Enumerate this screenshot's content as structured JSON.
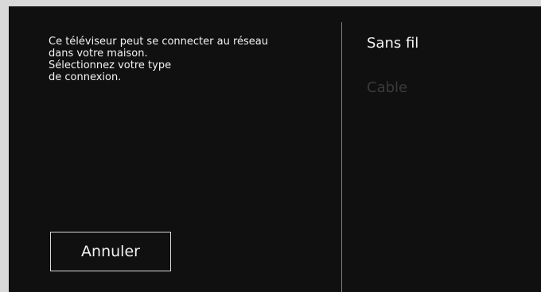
{
  "dialog": {
    "message_lines": [
      "Ce téléviseur peut se connecter au réseau",
      "dans votre maison.",
      "Sélectionnez votre type",
      "de connexion."
    ],
    "cancel_label": "Annuler"
  },
  "options": [
    {
      "label": "Sans fil",
      "state": "enabled"
    },
    {
      "label": "Cable",
      "state": "disabled"
    }
  ]
}
